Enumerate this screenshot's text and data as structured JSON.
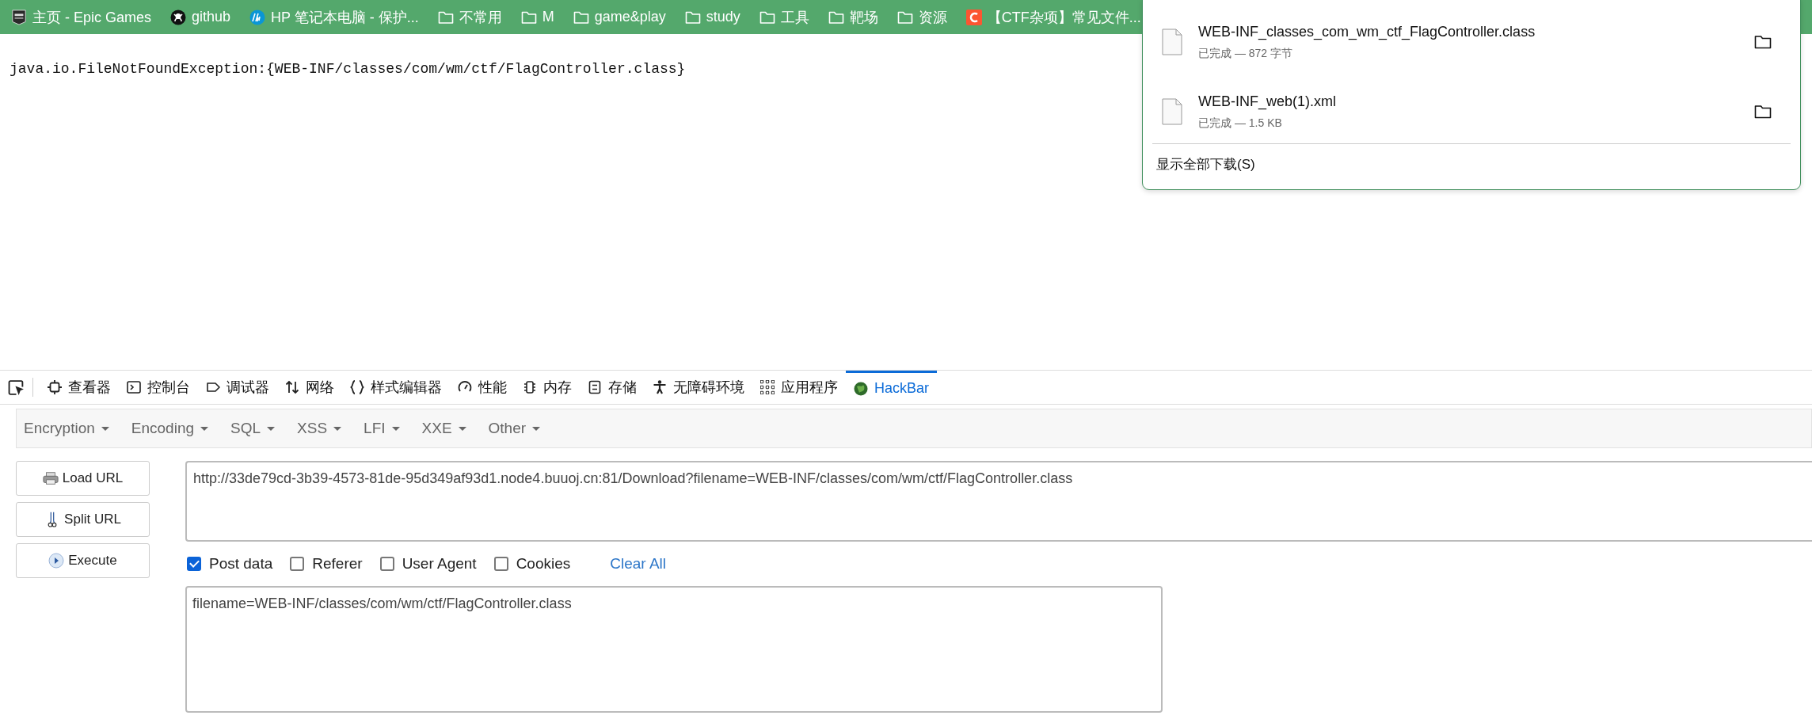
{
  "bookmarks": [
    {
      "label": "主页 - Epic Games",
      "kind": "epic"
    },
    {
      "label": "github",
      "kind": "github"
    },
    {
      "label": "HP 笔记本电脑 - 保护...",
      "kind": "hp"
    },
    {
      "label": "不常用",
      "kind": "folder"
    },
    {
      "label": "M",
      "kind": "folder"
    },
    {
      "label": "game&play",
      "kind": "folder"
    },
    {
      "label": "study",
      "kind": "folder"
    },
    {
      "label": "工具",
      "kind": "folder"
    },
    {
      "label": "靶场",
      "kind": "folder"
    },
    {
      "label": "资源",
      "kind": "folder"
    },
    {
      "label": "【CTF杂项】常见文件...",
      "kind": "csdn"
    }
  ],
  "page": {
    "error_text": "java.io.FileNotFoundException:{WEB-INF/classes/com/wm/ctf/FlagController.class}"
  },
  "downloads": {
    "items": [
      {
        "filename": "WEB-INF_classes_com_wm_ctf_FlagController.class",
        "status": "已完成 — 872 字节"
      },
      {
        "filename": "WEB-INF_web(1).xml",
        "status": "已完成 — 1.5 KB"
      }
    ],
    "show_all": "显示全部下载(S)"
  },
  "devtools": {
    "tabs": [
      {
        "label": "查看器",
        "kind": "inspector",
        "selected": false
      },
      {
        "label": "控制台",
        "kind": "console",
        "selected": false
      },
      {
        "label": "调试器",
        "kind": "debugger",
        "selected": false
      },
      {
        "label": "网络",
        "kind": "network",
        "selected": false
      },
      {
        "label": "样式编辑器",
        "kind": "style",
        "selected": false
      },
      {
        "label": "性能",
        "kind": "performance",
        "selected": false
      },
      {
        "label": "内存",
        "kind": "memory",
        "selected": false
      },
      {
        "label": "存储",
        "kind": "storage",
        "selected": false
      },
      {
        "label": "无障碍环境",
        "kind": "accessibility",
        "selected": false
      },
      {
        "label": "应用程序",
        "kind": "apps",
        "selected": false
      },
      {
        "label": "HackBar",
        "kind": "hackbar",
        "selected": true
      }
    ]
  },
  "hackbar": {
    "menus": [
      "Encryption",
      "Encoding",
      "SQL",
      "XSS",
      "LFI",
      "XXE",
      "Other"
    ],
    "buttons": [
      {
        "label": "Load URL",
        "kind": "load"
      },
      {
        "label": "Split URL",
        "kind": "split"
      },
      {
        "label": "Execute",
        "kind": "execute"
      }
    ],
    "url": "http://33de79cd-3b39-4573-81de-95d349af93d1.node4.buuoj.cn:81/Download?filename=WEB-INF/classes/com/wm/ctf/FlagController.class",
    "options": [
      {
        "label": "Post data",
        "checked": true
      },
      {
        "label": "Referer",
        "checked": false
      },
      {
        "label": "User Agent",
        "checked": false
      },
      {
        "label": "Cookies",
        "checked": false
      }
    ],
    "clear_all": "Clear All",
    "post_body": "filename=WEB-INF/classes/com/wm/ctf/FlagController.class"
  }
}
